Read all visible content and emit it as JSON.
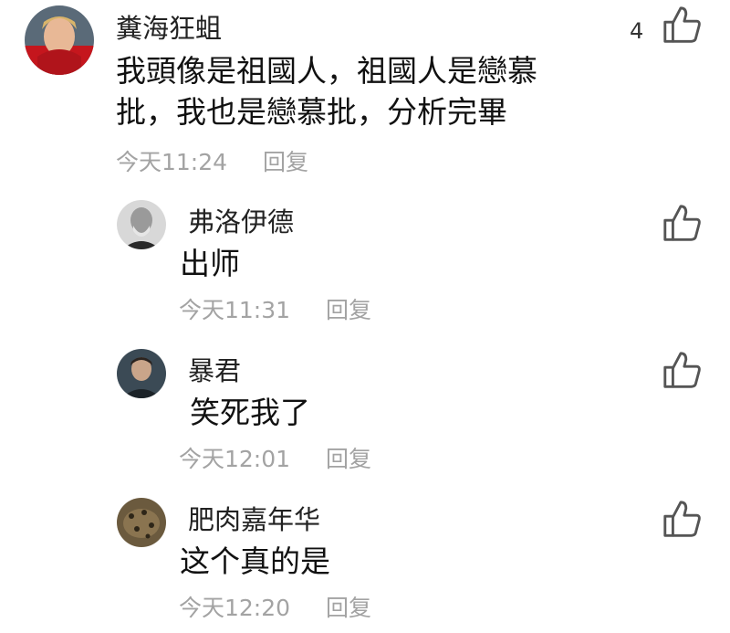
{
  "main_comment": {
    "author": "糞海狂蛆",
    "content_line1": "我頭像是祖國人，祖國人是戀慕",
    "content_line2": "批，我也是戀慕批，分析完畢",
    "time": "今天11:24",
    "reply_label": "回复",
    "like_count": "4",
    "like_icon": "thumbs-up-icon",
    "avatar_icon": "avatar"
  },
  "replies": [
    {
      "author": "弗洛伊德",
      "content": "出师",
      "time": "今天11:31",
      "reply_label": "回复",
      "like_icon": "thumbs-up-icon"
    },
    {
      "author": "暴君",
      "content": "笑死我了",
      "time": "今天12:01",
      "reply_label": "回复",
      "like_icon": "thumbs-up-icon"
    },
    {
      "author": "肥肉嘉年华",
      "content": "这个真的是",
      "time": "今天12:20",
      "reply_label": "回复",
      "like_icon": "thumbs-up-icon"
    }
  ],
  "colors": {
    "meta_text": "#a3a3a3",
    "icon_stroke": "#555555"
  }
}
